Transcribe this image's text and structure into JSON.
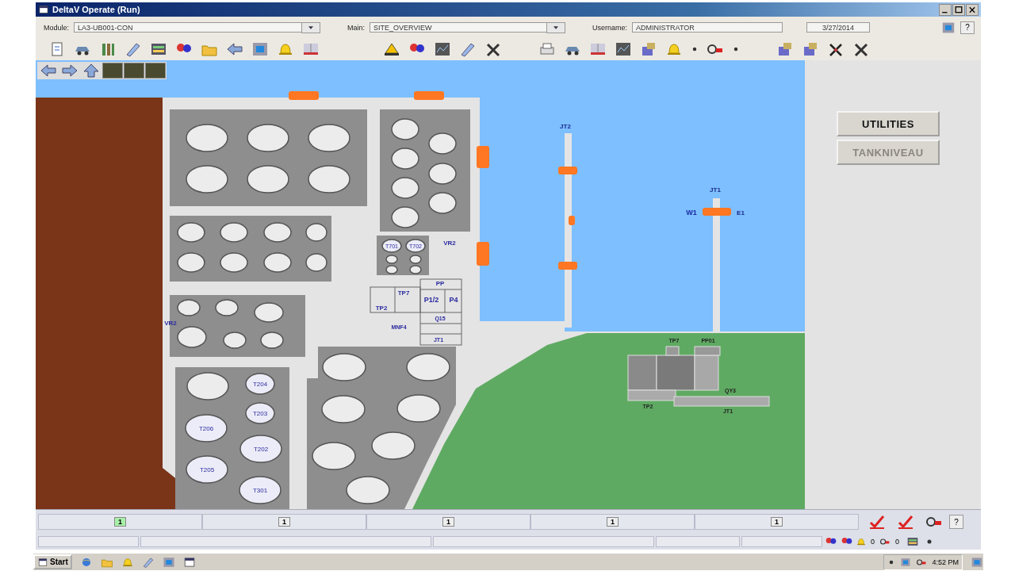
{
  "window": {
    "title": "DeltaV Operate (Run)"
  },
  "header": {
    "fields": [
      {
        "label": "Module:",
        "value": "LA3-UB001-CON",
        "dropdown": true
      },
      {
        "label": "Main:",
        "value": "SITE_OVERVIEW",
        "dropdown": true
      },
      {
        "label": "Username:",
        "value": "ADMINISTRATOR",
        "dropdown": false
      }
    ],
    "date": "3/27/2014",
    "help": "?"
  },
  "map": {
    "tanks": [
      {
        "label": "T701"
      },
      {
        "label": "T702"
      },
      {
        "label": "T204"
      },
      {
        "label": "T203"
      },
      {
        "label": "T206"
      },
      {
        "label": "T202"
      },
      {
        "label": "T205"
      },
      {
        "label": "T301"
      }
    ],
    "labels": [
      "VR2",
      "VR2",
      "TP7",
      "TP2",
      "PP",
      "P1/2",
      "P4",
      "Q15",
      "JT1",
      "MNF4",
      "JT2",
      "JT1",
      "W1",
      "E1",
      "TP7",
      "PP01",
      "QY3",
      "TP2",
      "JT1"
    ]
  },
  "buttons": [
    {
      "label": "UTILITIES",
      "disabled": false
    },
    {
      "label": "TANKNIVEAU",
      "disabled": true
    }
  ],
  "alarm_bar": {
    "slots": [
      {
        "count": "1",
        "active": true
      },
      {
        "count": "1",
        "active": false
      },
      {
        "count": "1",
        "active": false
      },
      {
        "count": "1",
        "active": false
      },
      {
        "count": "1",
        "active": false
      }
    ],
    "help": "?"
  },
  "status_bar": {
    "counters": [
      "0",
      "0"
    ]
  },
  "taskbar": {
    "start": "Start",
    "clock": "4:52 PM"
  }
}
